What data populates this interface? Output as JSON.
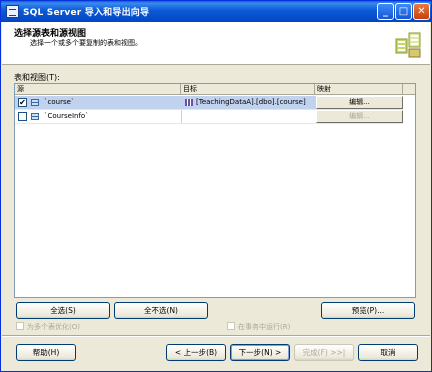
{
  "window": {
    "title": "SQL Server 导入和导出向导",
    "minimize": "_",
    "maximize": "□",
    "close": "✕"
  },
  "header": {
    "title": "选择源表和源视图",
    "subtitle": "选择一个或多个要复制的表和视图。",
    "icon": "wizard-tables-icon"
  },
  "list_label": "表和视图(T):",
  "grid": {
    "columns": [
      "源",
      "目标",
      "映射"
    ],
    "rows": [
      {
        "checked": true,
        "source": "`course`",
        "destination": "[TeachingDataA].[dbo].[course]",
        "mapping": "编辑...",
        "mapping_enabled": true,
        "selected": true
      },
      {
        "checked": false,
        "source": "`CourseInfo`",
        "destination": "",
        "mapping": "编辑...",
        "mapping_enabled": false,
        "selected": false
      }
    ]
  },
  "buttons": {
    "select_all": "全选(S)",
    "select_none": "全不选(N)",
    "preview": "预览(P)...",
    "help": "帮助(H)",
    "back": "< 上一步(B)",
    "next": "下一步(N) >",
    "finish": "完成(F) >>|",
    "cancel": "取消"
  },
  "options": {
    "optimize_multiple": "为多个表优化(O)",
    "run_in_transaction": "在事务中运行(R)"
  },
  "colors": {
    "title_bar": "#0a59d6",
    "selection": "#c1d2ee",
    "face": "#ece9d8"
  }
}
